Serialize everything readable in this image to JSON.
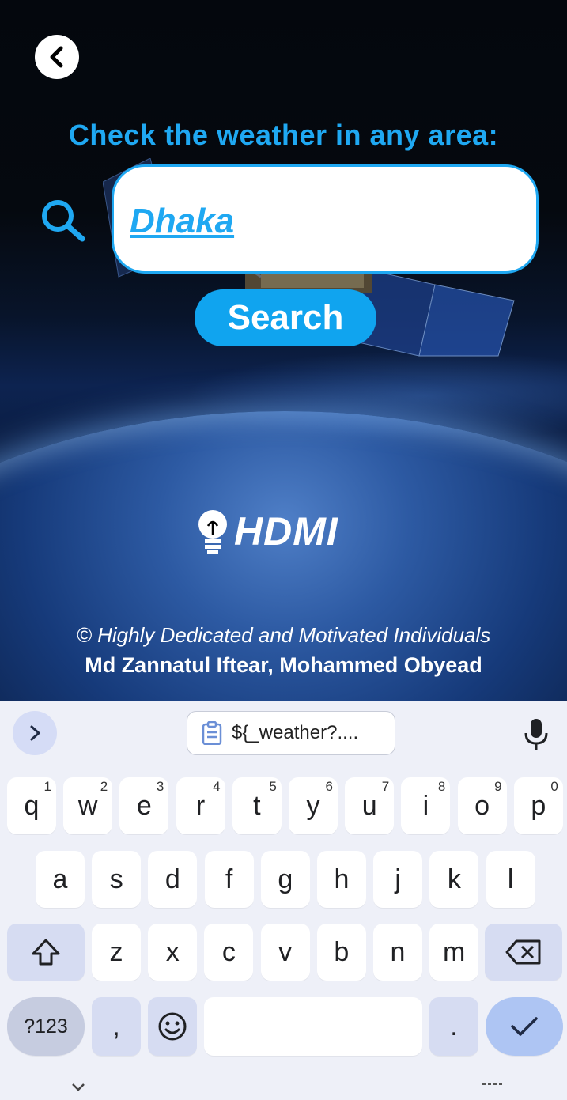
{
  "app": {
    "headline": "Check the weather in any area:",
    "search_value": "Dhaka",
    "search_button": "Search",
    "logo_text": "HDMI",
    "credit_line1": "© Highly Dedicated and Motivated Individuals",
    "credit_line2": "Md Zannatul Iftear, Mohammed Obyead"
  },
  "keyboard": {
    "clipboard_chip": "${_weather?....",
    "row1": [
      {
        "k": "q",
        "n": "1"
      },
      {
        "k": "w",
        "n": "2"
      },
      {
        "k": "e",
        "n": "3"
      },
      {
        "k": "r",
        "n": "4"
      },
      {
        "k": "t",
        "n": "5"
      },
      {
        "k": "y",
        "n": "6"
      },
      {
        "k": "u",
        "n": "7"
      },
      {
        "k": "i",
        "n": "8"
      },
      {
        "k": "o",
        "n": "9"
      },
      {
        "k": "p",
        "n": "0"
      }
    ],
    "row2": [
      "a",
      "s",
      "d",
      "f",
      "g",
      "h",
      "j",
      "k",
      "l"
    ],
    "row3": [
      "z",
      "x",
      "c",
      "v",
      "b",
      "n",
      "m"
    ],
    "sym_key": "?123",
    "comma_key": ",",
    "period_key": "."
  },
  "colors": {
    "accent": "#1fa8f2",
    "button": "#10a4ef",
    "keyboard_bg": "#eef0f8",
    "modifier_key": "#d6dcf2",
    "enter_key": "#aec5f3"
  }
}
